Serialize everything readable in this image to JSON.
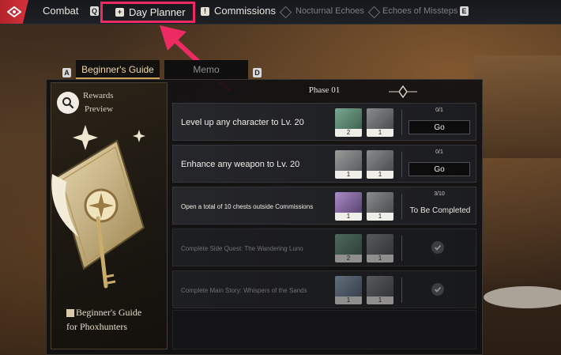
{
  "nav": {
    "combat": "Combat",
    "key_q": "Q",
    "day_planner": "Day Planner",
    "commissions": "Commissions",
    "nocturnal_echoes": "Nocturnal Echoes",
    "echoes_of_missteps": "Echoes of Missteps",
    "key_e": "E"
  },
  "tabs": {
    "key_a": "A",
    "beginners_guide": "Beginner's Guide",
    "memo": "Memo",
    "key_d": "D"
  },
  "left_card": {
    "rewards_line1": "Rewards",
    "rewards_line2": "Preview",
    "title_line1": "Beginner's Guide",
    "title_line2": "for Phoxhunters"
  },
  "phase": "Phase 01",
  "tasks": [
    {
      "text": "Level up any character to Lv. 20",
      "rewards": [
        {
          "qty": "2",
          "icon": "green-material-icon"
        },
        {
          "qty": "1",
          "icon": "weapon-material-icon"
        }
      ],
      "progress": "0/1",
      "action": "Go",
      "state": "go"
    },
    {
      "text": "Enhance any weapon to Lv. 20",
      "rewards": [
        {
          "qty": "1",
          "icon": "key-material-icon"
        },
        {
          "qty": "1",
          "icon": "weapon-material-icon"
        }
      ],
      "progress": "0/1",
      "action": "Go",
      "state": "go"
    },
    {
      "text": "Open a total of 10 chests outside Commissions",
      "rewards": [
        {
          "qty": "1",
          "icon": "purple-material-icon"
        },
        {
          "qty": "1",
          "icon": "weapon-material-icon"
        }
      ],
      "progress": "3/10",
      "action": "To Be Completed",
      "state": "pending"
    },
    {
      "text": "Complete Side Quest: The Wandering Luno",
      "rewards": [
        {
          "qty": "2",
          "icon": "green-material-icon"
        },
        {
          "qty": "1",
          "icon": "weapon-material-icon"
        }
      ],
      "progress": "",
      "action": "",
      "state": "done"
    },
    {
      "text": "Complete Main Story: Whispers of the Sands",
      "rewards": [
        {
          "qty": "1",
          "icon": "blue-material-icon"
        },
        {
          "qty": "1",
          "icon": "weapon-material-icon"
        }
      ],
      "progress": "",
      "action": "",
      "state": "done"
    }
  ],
  "colors": {
    "highlight": "#ee2a62",
    "logo_red": "#c8282f",
    "gold": "#caa35e"
  }
}
